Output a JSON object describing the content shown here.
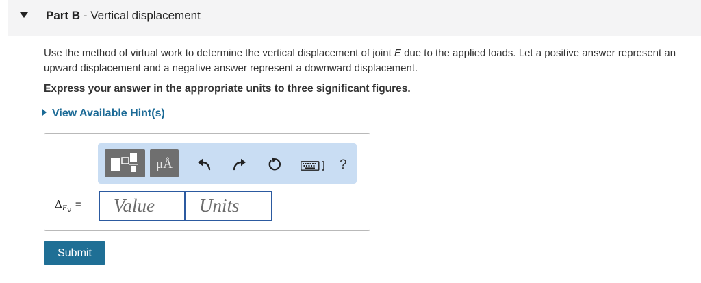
{
  "part": {
    "label": "Part B",
    "separator": " - ",
    "title": "Vertical displacement"
  },
  "question": {
    "text_before_joint": "Use the method of virtual work to determine the vertical displacement of joint ",
    "joint": "E",
    "text_after_joint": " due to the applied loads. Let a positive answer represent an upward displacement and a negative answer represent a downward displacement."
  },
  "instruction": "Express your answer in the appropriate units to three significant figures.",
  "hint_link": "View Available Hint(s)",
  "toolbar": {
    "units_button": "μÅ",
    "help_button": "?",
    "icons": [
      "templates-icon",
      "undo-icon",
      "redo-icon",
      "reset-icon",
      "keyboard-icon",
      "help-icon"
    ]
  },
  "answer": {
    "symbol": "Δ",
    "subscript": "E",
    "sub_subscript": "v",
    "equals": "=",
    "value_placeholder": "Value",
    "units_placeholder": "Units"
  },
  "submit_label": "Submit",
  "colors": {
    "header_bg": "#f4f4f5",
    "toolbar_bg": "#c9ddf3",
    "link": "#1b6a96",
    "submit_bg": "#1f6f95",
    "field_border": "#2c5aa0"
  }
}
